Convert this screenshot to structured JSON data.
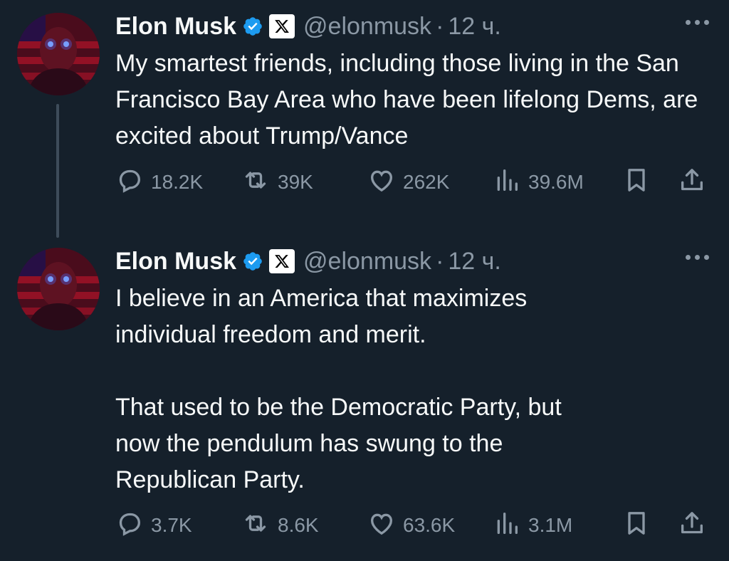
{
  "tweets": [
    {
      "author": {
        "name": "Elon Musk",
        "handle": "@elonmusk",
        "verified_icon": "verified-badge-icon",
        "affiliation_icon": "x-logo-icon"
      },
      "separator": "·",
      "time": "12 ч.",
      "text": [
        "My smartest friends, including those living in the San Francisco Bay Area who have been lifelong Dems, are excited about Trump/Vance"
      ],
      "stats": {
        "replies": "18.2K",
        "reposts": "39K",
        "likes": "262K",
        "views": "39.6M"
      }
    },
    {
      "author": {
        "name": "Elon Musk",
        "handle": "@elonmusk",
        "verified_icon": "verified-badge-icon",
        "affiliation_icon": "x-logo-icon"
      },
      "separator": "·",
      "time": "12 ч.",
      "text": [
        "I believe in an America that maximizes\nindividual freedom and merit.",
        "That used to be the Democratic Party, but\nnow the pendulum has swung to the\nRepublican Party."
      ],
      "stats": {
        "replies": "3.7K",
        "reposts": "8.6K",
        "likes": "63.6K",
        "views": "3.1M"
      }
    }
  ],
  "colors": {
    "background": "#15202b",
    "text_primary": "#f7f9f9",
    "text_secondary": "#8b98a5",
    "verified_blue": "#1d9bf0",
    "thread_line": "#3e4c5a"
  }
}
